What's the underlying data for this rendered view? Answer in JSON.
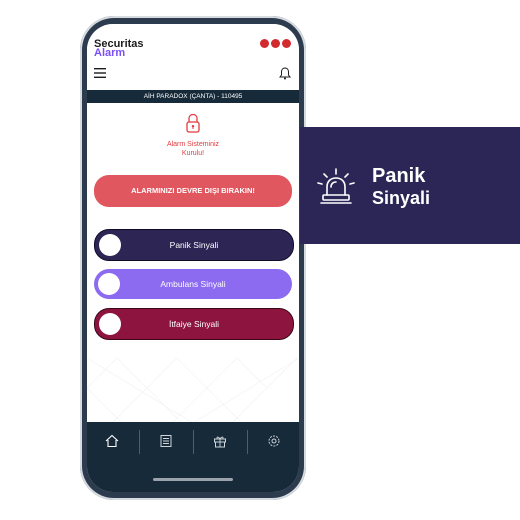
{
  "app": {
    "brand_line1": "Securitas",
    "brand_line2": "Alarm",
    "account": "AİH PARADOX (ÇANTA) - 110495"
  },
  "status": {
    "line1": "Alarm Sisteminiz",
    "line2": "Kurulu!"
  },
  "actions": {
    "disarm_label": "ALARMINIZI DEVRE DIŞI BIRAKIN!",
    "signals": [
      {
        "label": "Panik Sinyali",
        "color": "#2d2655"
      },
      {
        "label": "Ambulans Sinyali",
        "color": "#8c6bf0"
      },
      {
        "label": "İtfaiye Sinyali",
        "color": "#8d143f"
      }
    ]
  },
  "banner": {
    "line1": "Panik",
    "line2": "Sinyali",
    "icon": "siren-icon",
    "color": "#2b2656"
  },
  "nav": {
    "items": [
      "home-icon",
      "list-icon",
      "gift-icon",
      "settings-icon"
    ]
  },
  "colors": {
    "accent_red": "#e03b3f",
    "nav_bg": "#162a3a"
  }
}
